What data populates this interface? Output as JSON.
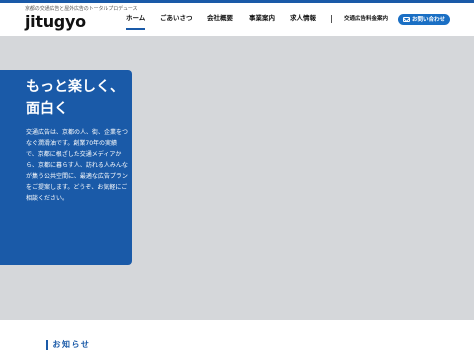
{
  "header": {
    "logo_tagline": "京都の交通広告と屋外広告のトータルプロデュース",
    "logo_text": "jitugyo",
    "nav": [
      {
        "label": "ホーム",
        "active": true
      },
      {
        "label": "ごあいさつ"
      },
      {
        "label": "会社概要"
      },
      {
        "label": "事業案内"
      },
      {
        "label": "求人情報"
      }
    ],
    "ad_rates_label": "交通広告料金案内",
    "contact_label": "お問い合わせ"
  },
  "hero": {
    "title_line1": "もっと楽しく、",
    "title_line2": "面白く",
    "body": "交通広告は、京都の人、街、企業をつなぐ潤滑油です。創業70年の実績で、京都に根ざした交通メディアから、京都に暮らす人、訪れる人みんなが集う公共空間に、最適な広告プランをご提案します。どうぞ、お気軽にご相談ください。"
  },
  "news": {
    "title": "お知らせ"
  },
  "colors": {
    "brand_blue": "#1a5aa8",
    "button_blue": "#1a6fc4",
    "hero_bg": "#d5d7da"
  }
}
